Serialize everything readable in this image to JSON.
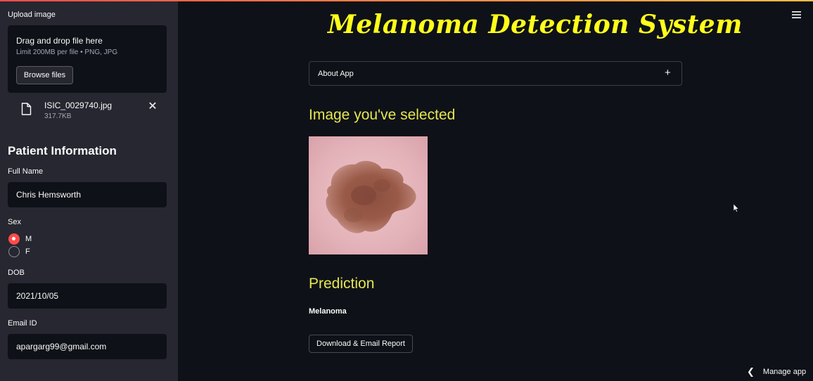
{
  "sidebar": {
    "upload_label": "Upload image",
    "dropzone_title": "Drag and drop file here",
    "dropzone_limit": "Limit 200MB per file • PNG, JPG",
    "browse_label": "Browse files",
    "uploaded_file": {
      "name": "ISIC_0029740.jpg",
      "size": "317.7KB"
    },
    "section_title": "Patient Information",
    "full_name_label": "Full Name",
    "full_name_value": "Chris Hemsworth",
    "sex_label": "Sex",
    "sex_options": [
      "M",
      "F"
    ],
    "sex_selected": "M",
    "dob_label": "DOB",
    "dob_value": "2021/10/05",
    "email_label": "Email ID",
    "email_value": "apargarg99@gmail.com"
  },
  "main": {
    "title": "Melanoma Detection System",
    "expander_label": "About App",
    "expander_icon": "+",
    "image_heading": "Image you've selected",
    "prediction_heading": "Prediction",
    "prediction_value": "Melanoma",
    "download_label": "Download & Email Report"
  },
  "footer": {
    "manage_label": "Manage app"
  },
  "colors": {
    "background": "#0e1117",
    "sidebar": "#262730",
    "title": "#ffff1a",
    "heading": "#e6e650",
    "accent": "#ff4b4b"
  },
  "icons": [
    "file-icon",
    "close-icon",
    "plus-icon",
    "hamburger-menu-icon",
    "chevron-left-icon",
    "mouse-cursor-icon"
  ]
}
